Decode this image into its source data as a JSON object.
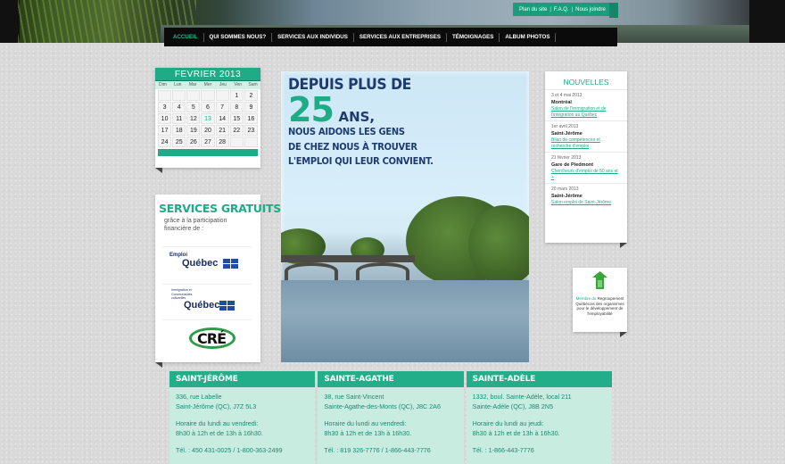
{
  "header": {
    "toplinks": [
      "Plan du site",
      "F.A.Q.",
      "Nous joindre"
    ]
  },
  "nav": [
    "ACCUEIL",
    "QUI SOMMES NOUS?",
    "SERVICES AUX INDIVIDUS",
    "SERVICES AUX ENTREPRISES",
    "TÉMOIGNAGES",
    "ALBUM PHOTOS"
  ],
  "calendar": {
    "month": "FEVRIER 2013",
    "days": [
      "Dim",
      "Lun",
      "Mar",
      "Mer",
      "Jeu",
      "Ven",
      "Sam"
    ],
    "cells": [
      "",
      "",
      "",
      "",
      "",
      "1",
      "2",
      "3",
      "4",
      "5",
      "6",
      "7",
      "8",
      "9",
      "10",
      "11",
      "12",
      "13",
      "14",
      "15",
      "16",
      "17",
      "18",
      "19",
      "20",
      "21",
      "22",
      "23",
      "24",
      "25",
      "26",
      "27",
      "28",
      "",
      ""
    ],
    "link_day": "13"
  },
  "services": {
    "title": "SERVICES GRATUITS",
    "subtitle": "grâce à la participation financière de :",
    "logo1_small": "Emploi",
    "logo1_big": "Québec",
    "logo2_small": "Immigration et Communautés culturelles",
    "logo2_big": "Québec",
    "logo3": "CRÉ"
  },
  "hero": {
    "line1": "DEPUIS PLUS DE",
    "number": "25",
    "ans": "ANS,",
    "line3": "NOUS AIDONS LES GENS",
    "line4": "DE CHEZ NOUS À TROUVER",
    "line5": "L'EMPLOI QUI LEUR CONVIENT."
  },
  "news": {
    "title": "NOUVELLES",
    "items": [
      {
        "date": "3 et 4 mai 2013",
        "place": "Montréal",
        "title": "Salon de l'immigration et de l'intégration au Québec"
      },
      {
        "date": "1er avril 2013",
        "place": "Saint-Jérôme",
        "title": "Bilan de compétences et recherche d'emploi"
      },
      {
        "date": "21 février 2013",
        "place": "Gare de Piedmont",
        "title": "Chercheurs d'emploi de 50 ans et +"
      },
      {
        "date": "20 mars 2013",
        "place": "Saint-Jérôme",
        "title": "Salon emploi de Saint-Jérôme"
      }
    ]
  },
  "membre": {
    "prefix": "Membre du",
    "text": "Regroupement Québécois des organismes pour le développement de l'employabilité"
  },
  "offices": [
    {
      "name": "SAINT-JÉRÔME",
      "addr1": "336, rue Labelle",
      "addr2": "Saint-Jérôme (QC), J7Z 5L3",
      "hours1": "Horaire du lundi au vendredi:",
      "hours2": "8h30 à 12h et de 13h à 16h30.",
      "tel": "Tél. : 450 431-0025 / 1-800-363-2499"
    },
    {
      "name": "SAINTE-AGATHE",
      "addr1": "38, rue Saint-Vincent",
      "addr2": "Sainte-Agathe-des-Monts (QC), J8C 2A6",
      "hours1": "Horaire du lundi au vendredi:",
      "hours2": "8h30 à 12h et de 13h à 16h30.",
      "tel": "Tél. : 819 326-7776 / 1-866-443-7776"
    },
    {
      "name": "SAINTE-ADÈLE",
      "addr1": "1332, boul. Sainte-Adèle, local 211",
      "addr2": "Sainte-Adèle (QC), J8B 2N5",
      "hours1": "Horaire du lundi au jeudi:",
      "hours2": "8h30 à 12h et de 13h à 16h30.",
      "tel": "Tél. : 1-866-443-7776"
    }
  ],
  "colors": {
    "accent": "#1eab86",
    "nav_bg": "#0b0b0b",
    "hero_text": "#1e3b6e",
    "office_bg": "#c8ece0"
  }
}
